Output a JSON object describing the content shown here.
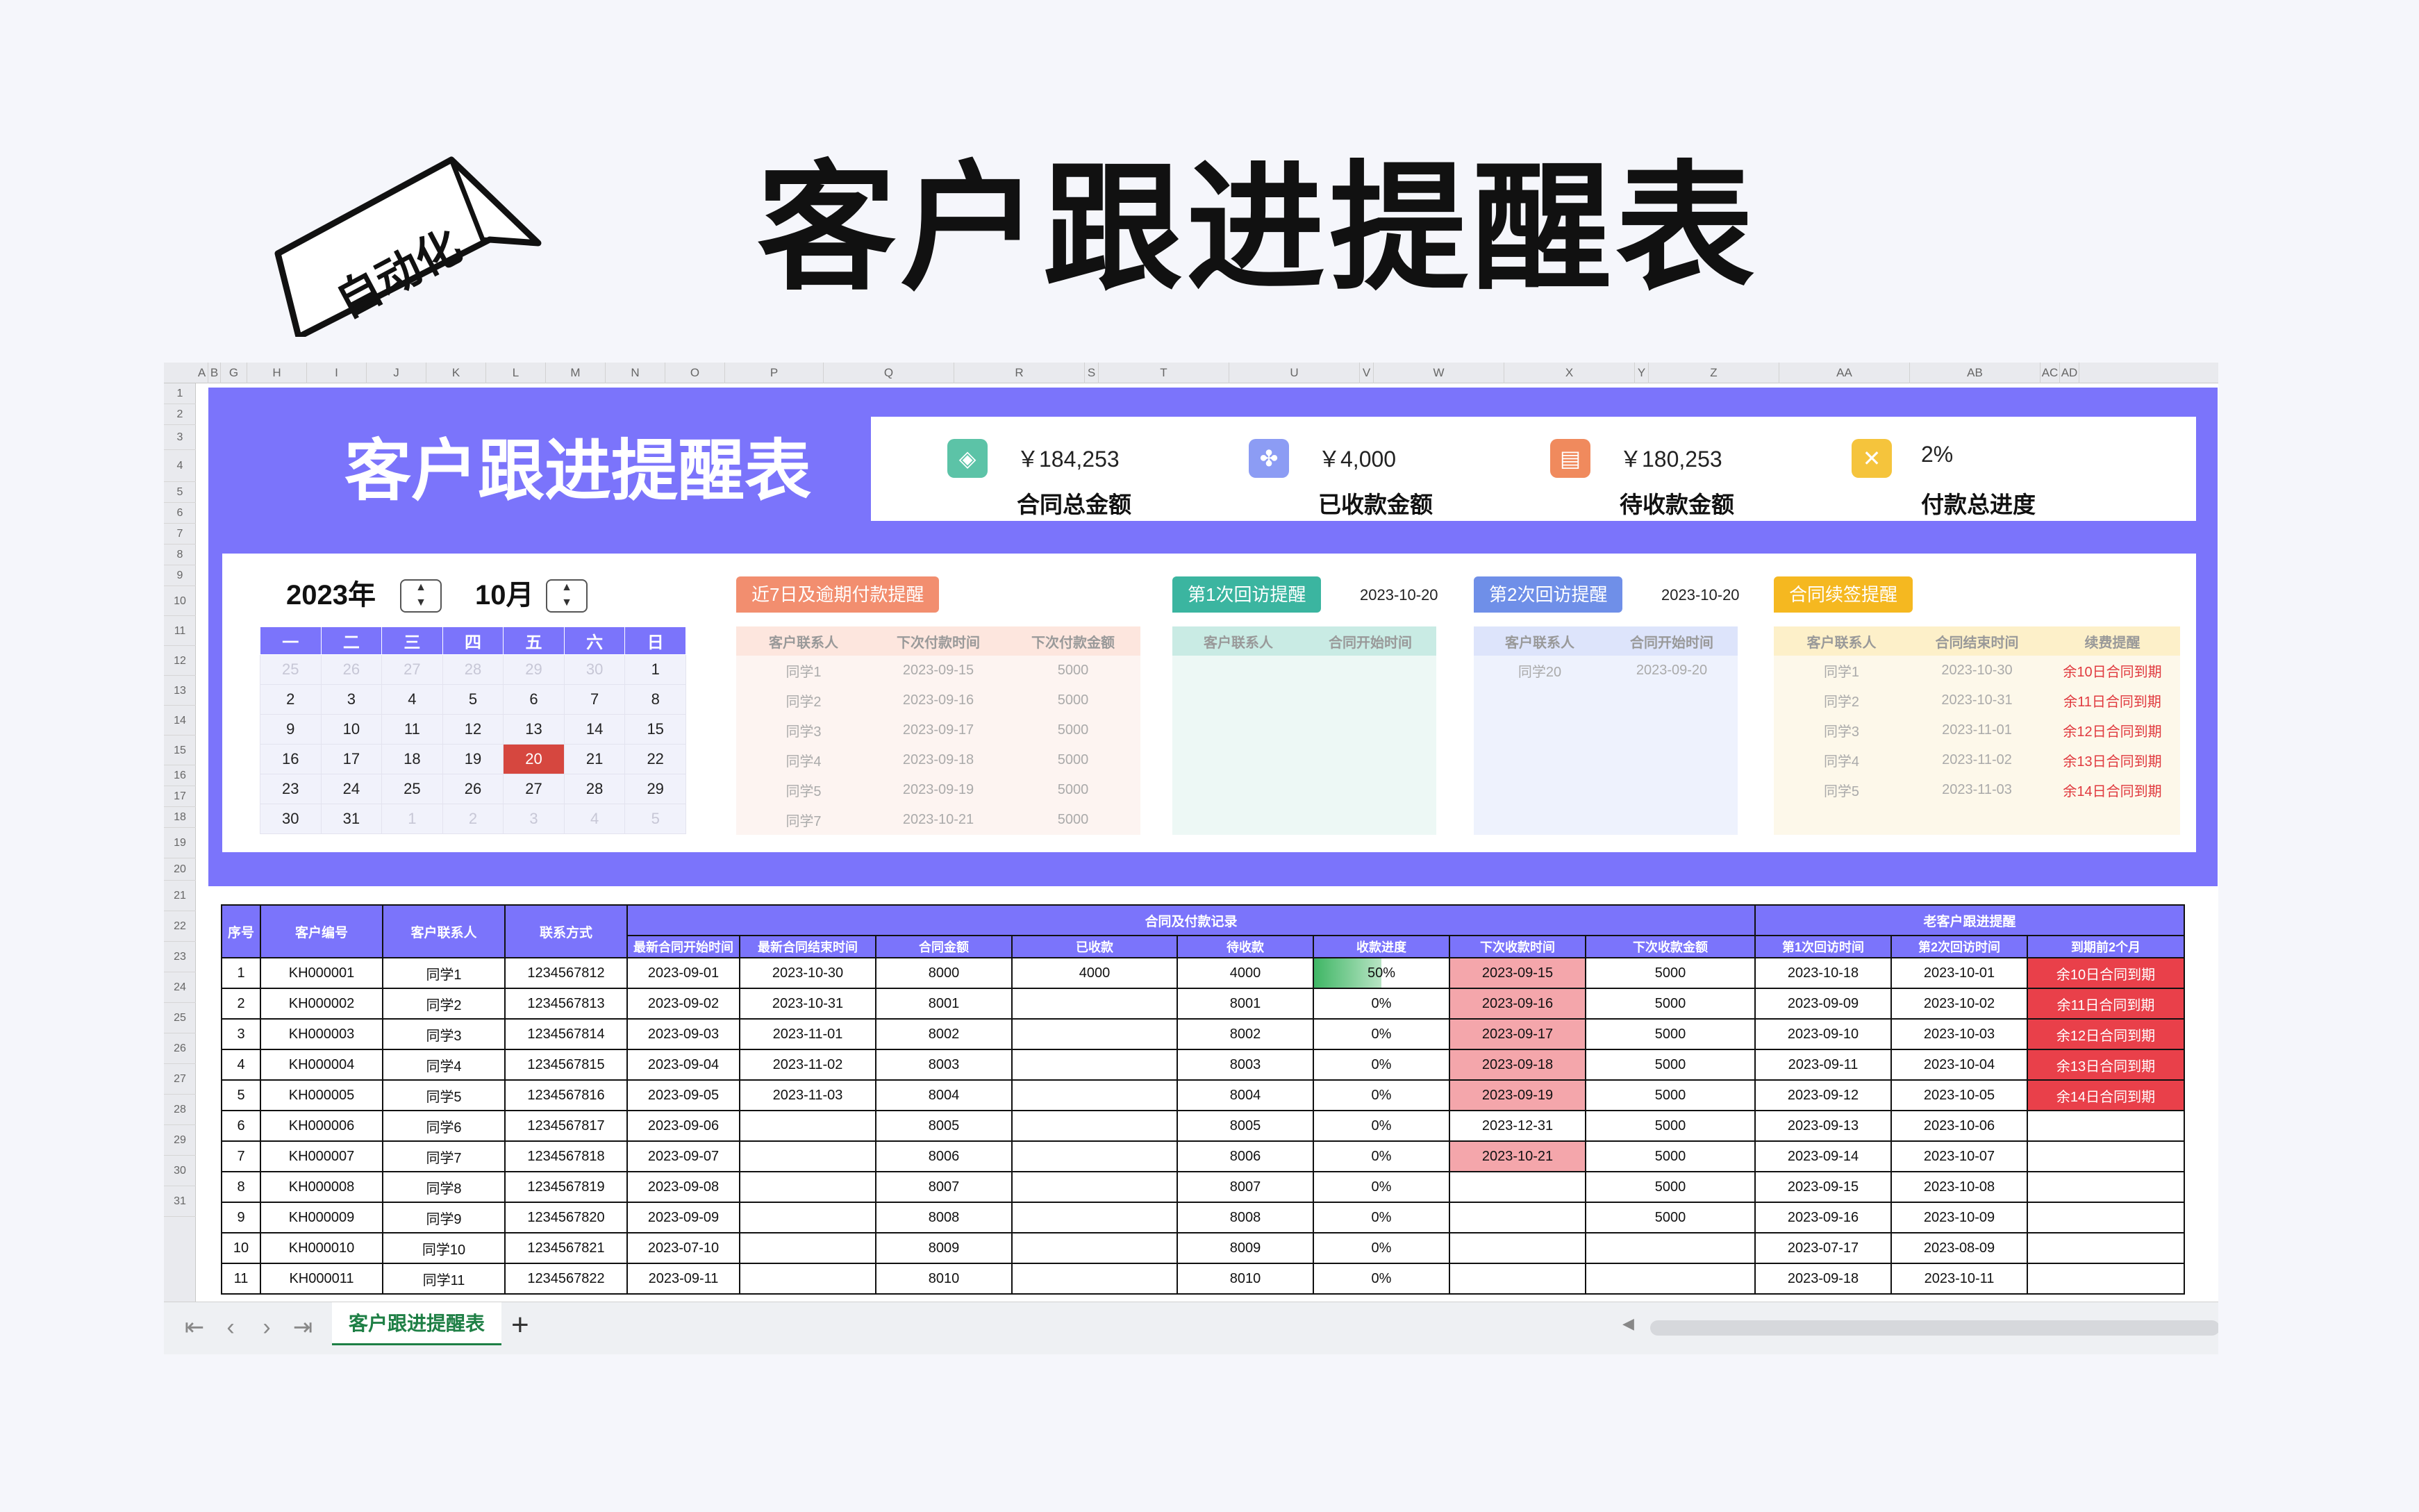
{
  "hero_title": "客户跟进提醒表",
  "auto_tag": "自动化",
  "sheet": {
    "columns": [
      "A",
      "B",
      "G",
      "H",
      "I",
      "J",
      "K",
      "L",
      "M",
      "N",
      "O",
      "P",
      "Q",
      "R",
      "S",
      "T",
      "U",
      "V",
      "W",
      "X",
      "Y",
      "Z",
      "AA",
      "AB",
      "AC",
      "AD"
    ],
    "rows": [
      "1",
      "2",
      "3",
      "4",
      "5",
      "6",
      "7",
      "8",
      "9",
      "10",
      "11",
      "12",
      "13",
      "14",
      "15",
      "16",
      "17",
      "18",
      "19",
      "20",
      "21",
      "22",
      "23",
      "24",
      "25",
      "26",
      "27",
      "28",
      "29",
      "30",
      "31"
    ],
    "title": "客户跟进提醒表",
    "stats": [
      {
        "icon": "layers-icon",
        "color": "#5cc3a7",
        "value": "￥184,253",
        "label": "合同总金额"
      },
      {
        "icon": "grid-icon",
        "color": "#8c9cf4",
        "value": "￥4,000",
        "label": "已收款金额"
      },
      {
        "icon": "document-icon",
        "color": "#f08a5d",
        "value": "￥180,253",
        "label": "待收款金额"
      },
      {
        "icon": "percent-icon",
        "color": "#f5c43c",
        "value": "2%",
        "label": "付款总进度"
      }
    ],
    "calendar": {
      "year": "2023年",
      "month": "10月",
      "weekdays": [
        "一",
        "二",
        "三",
        "四",
        "五",
        "六",
        "日"
      ],
      "weeks": [
        [
          "25",
          "26",
          "27",
          "28",
          "29",
          "30",
          "1"
        ],
        [
          "2",
          "3",
          "4",
          "5",
          "6",
          "7",
          "8"
        ],
        [
          "9",
          "10",
          "11",
          "12",
          "13",
          "14",
          "15"
        ],
        [
          "16",
          "17",
          "18",
          "19",
          "20",
          "21",
          "22"
        ],
        [
          "23",
          "24",
          "25",
          "26",
          "27",
          "28",
          "29"
        ],
        [
          "30",
          "31",
          "1",
          "2",
          "3",
          "4",
          "5"
        ]
      ],
      "today": "20"
    },
    "reminders": {
      "payment": {
        "tab": "近7日及逾期付款提醒",
        "color": "#f28e6f",
        "headers": [
          "客户联系人",
          "下次付款时间",
          "下次付款金额"
        ],
        "rows": [
          [
            "同学1",
            "2023-09-15",
            "5000"
          ],
          [
            "同学2",
            "2023-09-16",
            "5000"
          ],
          [
            "同学3",
            "2023-09-17",
            "5000"
          ],
          [
            "同学4",
            "2023-09-18",
            "5000"
          ],
          [
            "同学5",
            "2023-09-19",
            "5000"
          ],
          [
            "同学7",
            "2023-10-21",
            "5000"
          ]
        ]
      },
      "visit1": {
        "tab": "第1次回访提醒",
        "color": "#3bb5a0",
        "date": "2023-10-20",
        "headers": [
          "客户联系人",
          "合同开始时间"
        ],
        "rows": []
      },
      "visit2": {
        "tab": "第2次回访提醒",
        "color": "#6f8fe8",
        "date": "2023-10-20",
        "headers": [
          "客户联系人",
          "合同开始时间"
        ],
        "rows": [
          [
            "同学20",
            "2023-09-20"
          ]
        ]
      },
      "renewal": {
        "tab": "合同续签提醒",
        "color": "#f5b820",
        "headers": [
          "客户联系人",
          "合同结束时间",
          "续费提醒"
        ],
        "rows": [
          [
            "同学1",
            "2023-10-30",
            "余10日合同到期"
          ],
          [
            "同学2",
            "2023-10-31",
            "余11日合同到期"
          ],
          [
            "同学3",
            "2023-11-01",
            "余12日合同到期"
          ],
          [
            "同学4",
            "2023-11-02",
            "余13日合同到期"
          ],
          [
            "同学5",
            "2023-11-03",
            "余14日合同到期"
          ]
        ]
      }
    },
    "table": {
      "group_headers": {
        "contract": "合同及付款记录",
        "followup": "老客户跟进提醒"
      },
      "headers": [
        "序号",
        "客户编号",
        "客户联系人",
        "联系方式",
        "最新合同开始时间",
        "最新合同结束时间",
        "合同金额",
        "已收款",
        "待收款",
        "收款进度",
        "下次收款时间",
        "下次收款金额",
        "第1次回访时间",
        "第2次回访时间",
        "到期前2个月"
      ],
      "rows": [
        [
          "1",
          "KH000001",
          "同学1",
          "1234567812",
          "2023-09-01",
          "2023-10-30",
          "8000",
          "4000",
          "4000",
          "50%",
          "2023-09-15",
          "5000",
          "2023-10-18",
          "2023-10-01",
          "余10日合同到期"
        ],
        [
          "2",
          "KH000002",
          "同学2",
          "1234567813",
          "2023-09-02",
          "2023-10-31",
          "8001",
          "",
          "8001",
          "0%",
          "2023-09-16",
          "5000",
          "2023-09-09",
          "2023-10-02",
          "余11日合同到期"
        ],
        [
          "3",
          "KH000003",
          "同学3",
          "1234567814",
          "2023-09-03",
          "2023-11-01",
          "8002",
          "",
          "8002",
          "0%",
          "2023-09-17",
          "5000",
          "2023-09-10",
          "2023-10-03",
          "余12日合同到期"
        ],
        [
          "4",
          "KH000004",
          "同学4",
          "1234567815",
          "2023-09-04",
          "2023-11-02",
          "8003",
          "",
          "8003",
          "0%",
          "2023-09-18",
          "5000",
          "2023-09-11",
          "2023-10-04",
          "余13日合同到期"
        ],
        [
          "5",
          "KH000005",
          "同学5",
          "1234567816",
          "2023-09-05",
          "2023-11-03",
          "8004",
          "",
          "8004",
          "0%",
          "2023-09-19",
          "5000",
          "2023-09-12",
          "2023-10-05",
          "余14日合同到期"
        ],
        [
          "6",
          "KH000006",
          "同学6",
          "1234567817",
          "2023-09-06",
          "",
          "8005",
          "",
          "8005",
          "0%",
          "2023-12-31",
          "5000",
          "2023-09-13",
          "2023-10-06",
          ""
        ],
        [
          "7",
          "KH000007",
          "同学7",
          "1234567818",
          "2023-09-07",
          "",
          "8006",
          "",
          "8006",
          "0%",
          "2023-10-21",
          "5000",
          "2023-09-14",
          "2023-10-07",
          ""
        ],
        [
          "8",
          "KH000008",
          "同学8",
          "1234567819",
          "2023-09-08",
          "",
          "8007",
          "",
          "8007",
          "0%",
          "",
          "5000",
          "2023-09-15",
          "2023-10-08",
          ""
        ],
        [
          "9",
          "KH000009",
          "同学9",
          "1234567820",
          "2023-09-09",
          "",
          "8008",
          "",
          "8008",
          "0%",
          "",
          "5000",
          "2023-09-16",
          "2023-10-09",
          ""
        ],
        [
          "10",
          "KH000010",
          "同学10",
          "1234567821",
          "2023-07-10",
          "",
          "8009",
          "",
          "8009",
          "0%",
          "",
          "",
          "2023-07-17",
          "2023-08-09",
          ""
        ],
        [
          "11",
          "KH000011",
          "同学11",
          "1234567822",
          "2023-09-11",
          "",
          "8010",
          "",
          "8010",
          "0%",
          "",
          "",
          "2023-09-18",
          "2023-10-11",
          ""
        ]
      ],
      "due_highlight_rows": [
        0,
        1,
        2,
        3,
        4,
        6
      ],
      "progress_first": 0.5
    },
    "tab_bar": {
      "active_tab": "客户跟进提醒表",
      "add": "+"
    }
  }
}
